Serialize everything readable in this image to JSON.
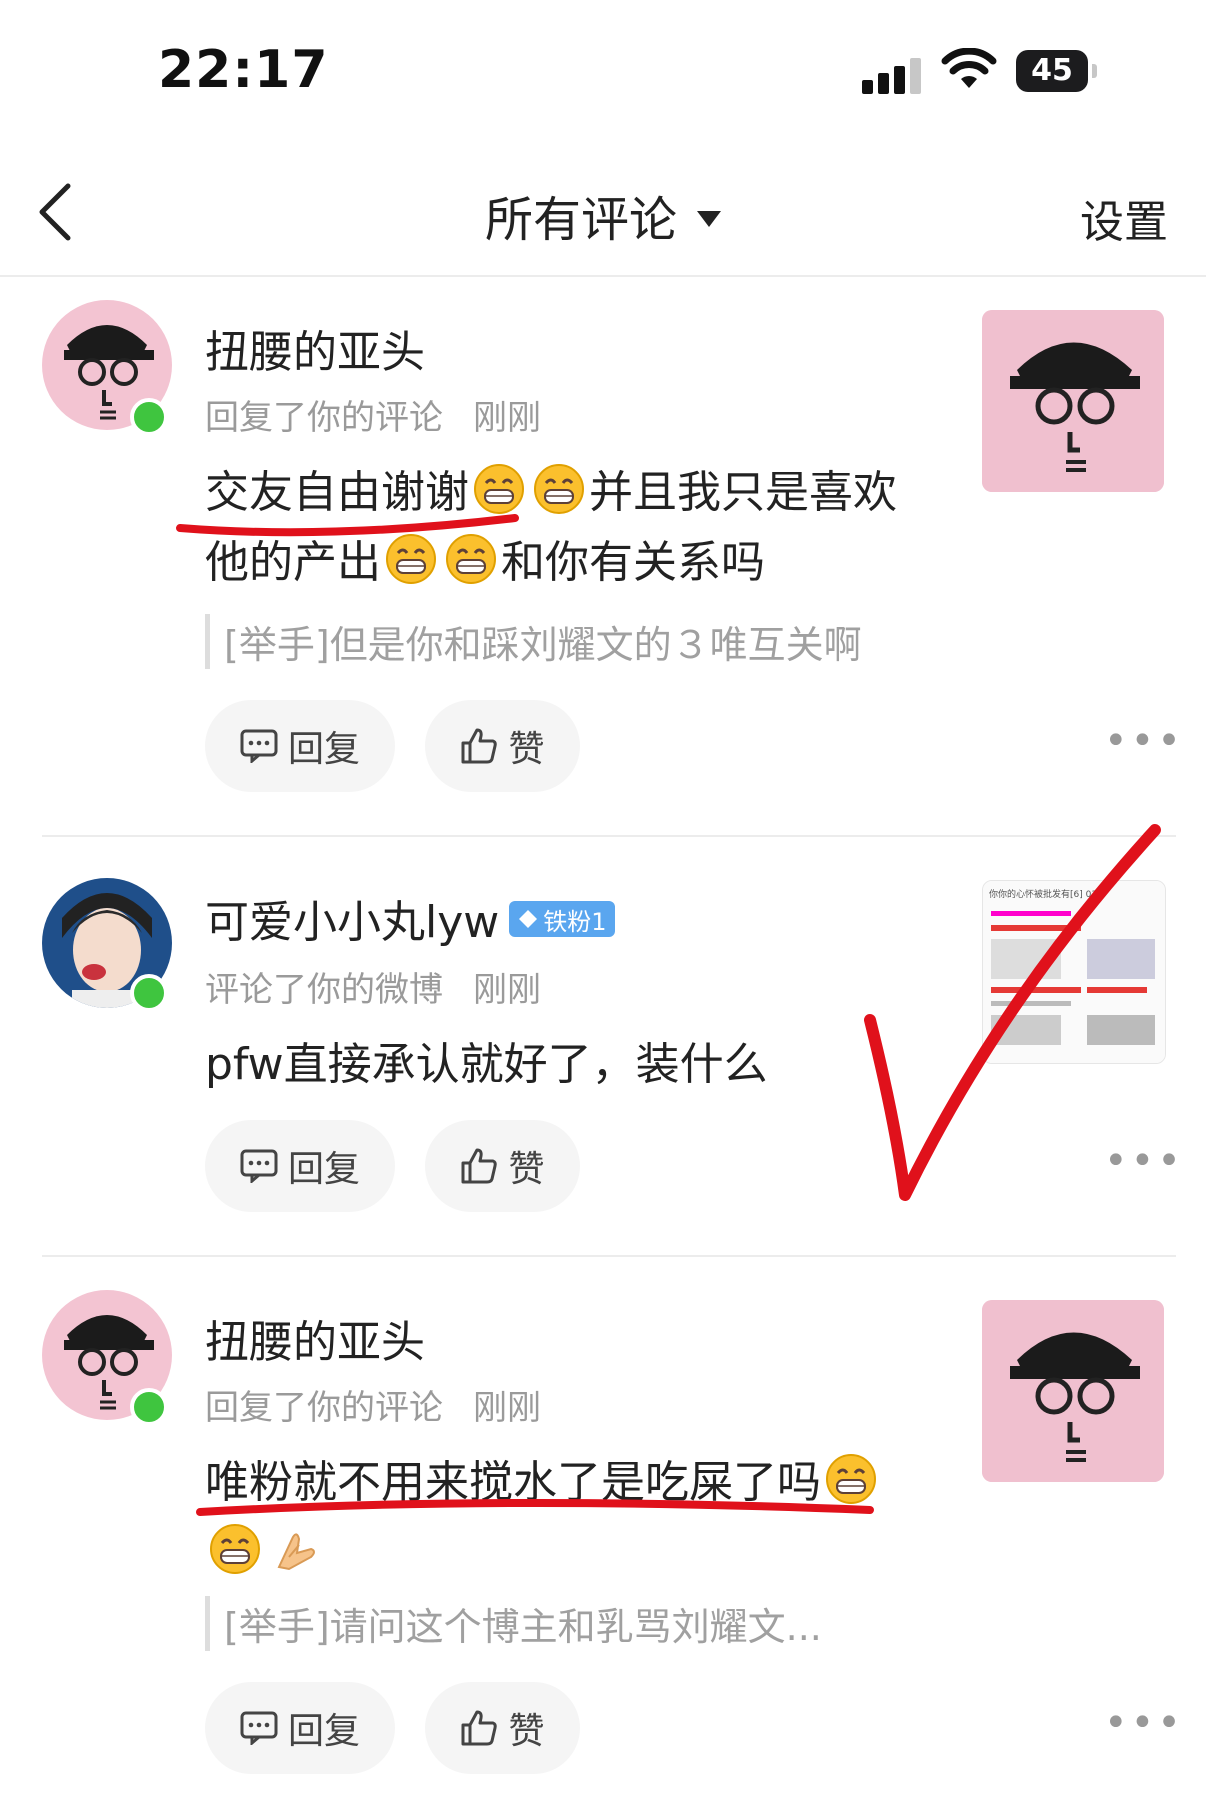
{
  "status_bar": {
    "time": "22:17",
    "battery": "45"
  },
  "nav": {
    "title": "所有评论",
    "settings": "设置"
  },
  "comments": [
    {
      "name": "扭腰的亚头",
      "action": "回复了你的评论",
      "time": "刚刚",
      "text_a": "交友自由谢谢",
      "text_b": "并且我只是喜欢他的产出",
      "text_c": "和你有关系吗",
      "quote": "[举手]但是你和踩刘耀文的３唯互关啊",
      "reply_label": "回复",
      "like_label": "赞"
    },
    {
      "name": "可爱小小丸lyw",
      "badge": "铁粉1",
      "action": "评论了你的微博",
      "time": "刚刚",
      "text_a": "pfw直接承认就好了，装什么",
      "reply_label": "回复",
      "like_label": "赞"
    },
    {
      "name": "扭腰的亚头",
      "action": "回复了你的评论",
      "time": "刚刚",
      "text_a": "唯粉就不用来搅水了是吃屎了吗",
      "quote": "[举手]请问这个博主和乳骂刘耀文...",
      "reply_label": "回复",
      "like_label": "赞"
    }
  ],
  "thumbnail_text": "你你的心怀被批发有[6] 03",
  "colors": {
    "accent_red": "#e0111b",
    "online_green": "#3fc53f",
    "badge_blue": "#5aa6ef"
  },
  "icons": [
    "back-chevron-icon",
    "dropdown-caret-icon",
    "comment-icon",
    "thumb-up-icon",
    "more-dots-icon",
    "grin-emoji",
    "pray-emoji"
  ]
}
